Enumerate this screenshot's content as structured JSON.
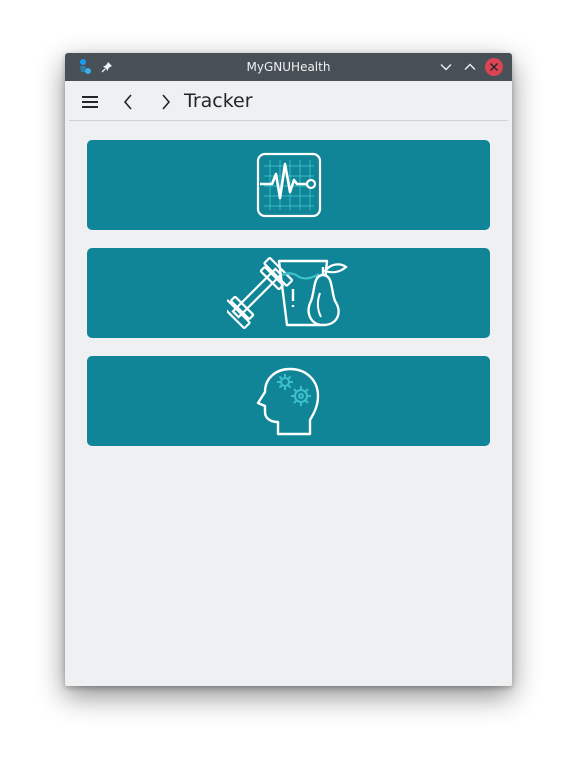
{
  "window": {
    "title": "MyGNUHealth"
  },
  "toolbar": {
    "page_title": "Tracker"
  },
  "cards": [
    {
      "icon": "vital-signs-monitor-icon"
    },
    {
      "icon": "lifestyle-fitness-nutrition-icon"
    },
    {
      "icon": "mood-mental-health-icon"
    }
  ],
  "colors": {
    "titlebar": "#475057",
    "card": "#0f8597",
    "background": "#eff0f1",
    "close": "#da4453"
  }
}
